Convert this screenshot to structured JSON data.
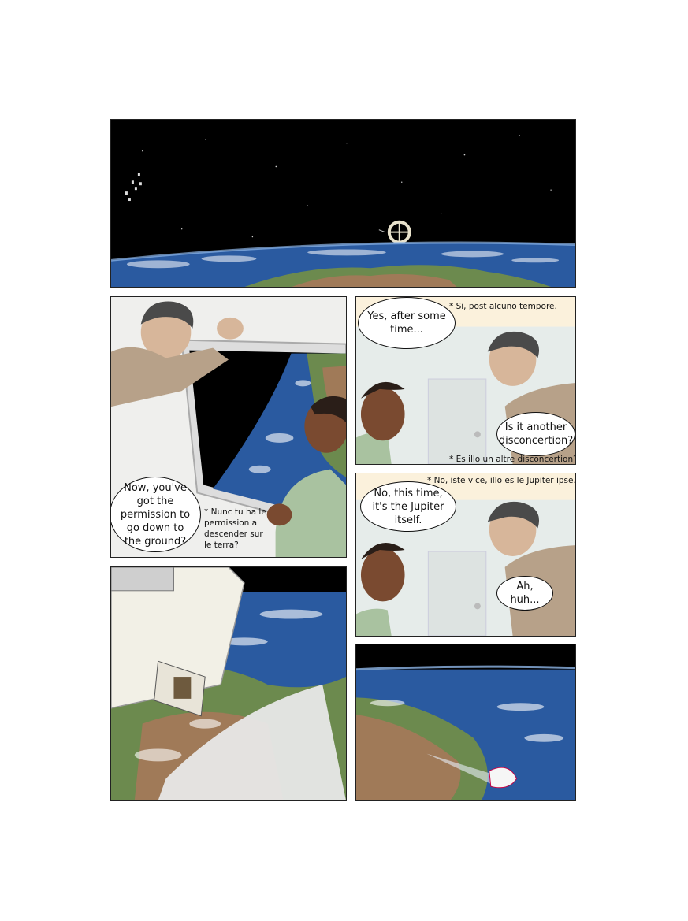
{
  "panels": [
    {
      "id": "p1",
      "scene": "space-station-above-earth"
    },
    {
      "id": "p2",
      "scene": "window-view"
    },
    {
      "id": "p3",
      "scene": "conversation"
    },
    {
      "id": "p4",
      "scene": "conversation"
    },
    {
      "id": "p5",
      "scene": "shuttle-departure"
    },
    {
      "id": "p6",
      "scene": "shuttle-reentry"
    }
  ],
  "dialogue": {
    "p2_bubble": "Now, you've got the permission to go down to the ground?",
    "p2_note": "* Nunc tu ha le permission a descender sur le terra?",
    "p3_bubble_1": "Yes, after some time...",
    "p3_note_1": "* Si, post alcuno tempore.",
    "p3_bubble_2": "Is it another disconcertion?",
    "p3_note_2": "* Es illo un altre disconcertion?",
    "p4_note": "* No, iste vice, illo es le Jupiter ipse.",
    "p4_bubble_1": "No, this time, it's the Jupiter itself.",
    "p4_bubble_2": "Ah, huh..."
  },
  "colors": {
    "space": "#000000",
    "ocean": "#2a5aa0",
    "land_green": "#5f8a4a",
    "land_brown": "#a07a58",
    "jacket": "#b7a189",
    "shirt": "#a9c2a0",
    "skin_light": "#d7b69a",
    "skin_dark": "#7a4a30"
  }
}
